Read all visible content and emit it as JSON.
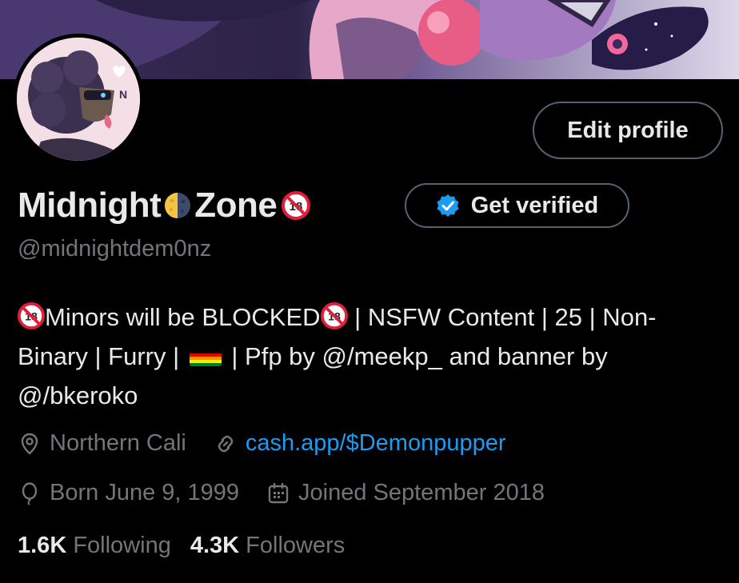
{
  "profile": {
    "name_part1": "Midnight",
    "name_part2": "Zone",
    "handle": "@midnightdem0nz",
    "edit_profile_label": "Edit profile",
    "get_verified_label": "Get verified",
    "bio": {
      "segment1": "Minors will be BLOCKED",
      "segment2": " | NSFW Content | 25 | Non-Binary | Furry | ",
      "segment3": " | Pfp by @/meekp_ and banner by @/bkeroko"
    },
    "location": "Northern Cali",
    "website": "cash.app/$Demonpupper",
    "birthday": "Born June 9, 1999",
    "joined": "Joined September 2018",
    "following_count": "1.6K",
    "following_label": "Following",
    "followers_count": "4.3K",
    "followers_label": "Followers"
  },
  "colors": {
    "background": "#000000",
    "text_primary": "#e7e9ea",
    "text_secondary": "#71767b",
    "link": "#1d9bf0",
    "border": "#536471",
    "verified_badge": "#1d9bf0"
  },
  "icons": {
    "location": "location-pin-icon",
    "website": "link-icon",
    "birthday": "balloon-icon",
    "joined": "calendar-icon",
    "verified": "verified-badge-icon",
    "nsfw": "no-under-18-icon",
    "moon": "half-moon-emoji-icon",
    "pride_flag": "rainbow-flag-emoji-icon"
  }
}
